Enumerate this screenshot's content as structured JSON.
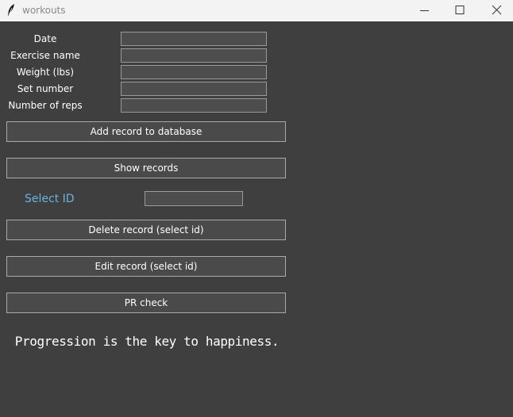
{
  "window": {
    "title": "workouts",
    "controls": {
      "minimize_icon": "minimize-icon",
      "maximize_icon": "maximize-icon",
      "close_icon": "close-icon"
    }
  },
  "form": {
    "fields": [
      {
        "label": "Date",
        "value": ""
      },
      {
        "label": "Exercise name",
        "value": ""
      },
      {
        "label": "Weight (lbs)",
        "value": ""
      },
      {
        "label": "Set number",
        "value": ""
      },
      {
        "label": "Number of reps",
        "value": ""
      }
    ]
  },
  "buttons": {
    "add": "Add record to database",
    "show": "Show records",
    "delete": "Delete record (select id)",
    "edit": "Edit record (select id)",
    "pr": "PR check"
  },
  "select_id": {
    "label": "Select ID",
    "value": ""
  },
  "motto": "Progression is the key to happiness.",
  "colors": {
    "background": "#3f3f3f",
    "titlebar": "#f3f3f3",
    "select_label": "#6ab2e0"
  }
}
